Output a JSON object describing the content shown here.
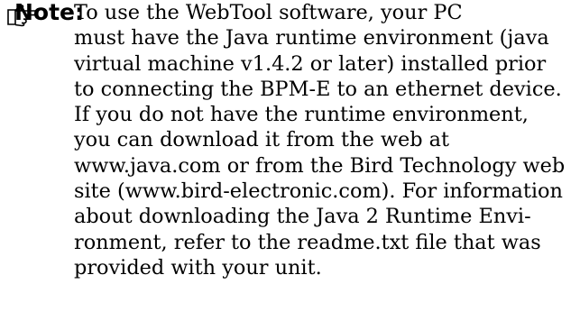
{
  "note": {
    "icon": "pointing-hand-icon",
    "label": "Note:",
    "lines": [
      "To use the WebTool software, your PC",
      "must have the Java runtime environment (java",
      "virtual machine v1.4.2 or later) installed prior",
      "to connecting the BPM-E to an ethernet device.",
      "If you do not have the runtime environment,",
      "you can download it from the web at",
      "www.java.com or from the Bird Technology web",
      "site (www.bird-electronic.com). For information",
      "about downloading the Java 2 Runtime Envi-",
      "ronment, refer to the readme.txt file that was",
      "provided with your unit."
    ]
  }
}
